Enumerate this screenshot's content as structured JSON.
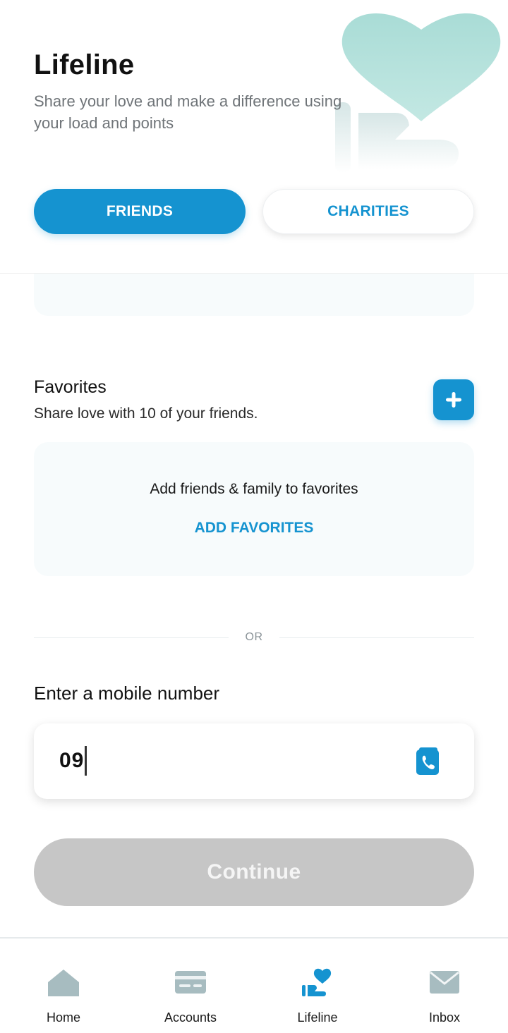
{
  "header": {
    "title": "Lifeline",
    "subtitle": "Share your love and make a difference using your load and points"
  },
  "tabs": [
    {
      "label": "FRIENDS",
      "selected": true
    },
    {
      "label": "CHARITIES",
      "selected": false
    }
  ],
  "favorites": {
    "title": "Favorites",
    "subtitle": "Share love with 10 of your friends.",
    "add_icon": "plus-icon",
    "empty_text": "Add friends & family to favorites",
    "add_link": "ADD FAVORITES"
  },
  "divider": {
    "text": "OR"
  },
  "mobile": {
    "label": "Enter a mobile number",
    "value": "09",
    "contacts_icon": "phone-book-icon"
  },
  "continue_button": {
    "label": "Continue",
    "enabled": false
  },
  "bottom_nav": [
    {
      "label": "Home",
      "icon": "home-icon",
      "active": false
    },
    {
      "label": "Accounts",
      "icon": "card-icon",
      "active": false
    },
    {
      "label": "Lifeline",
      "icon": "heart-hand-icon",
      "active": true
    },
    {
      "label": "Inbox",
      "icon": "mail-icon",
      "active": false
    }
  ],
  "colors": {
    "accent": "#1593d0",
    "disabled": "#c6c6c6",
    "card_bg": "#f7fbfc",
    "hero_heart": "#a9dcd6",
    "nav_inactive": "#a7bcc0"
  }
}
